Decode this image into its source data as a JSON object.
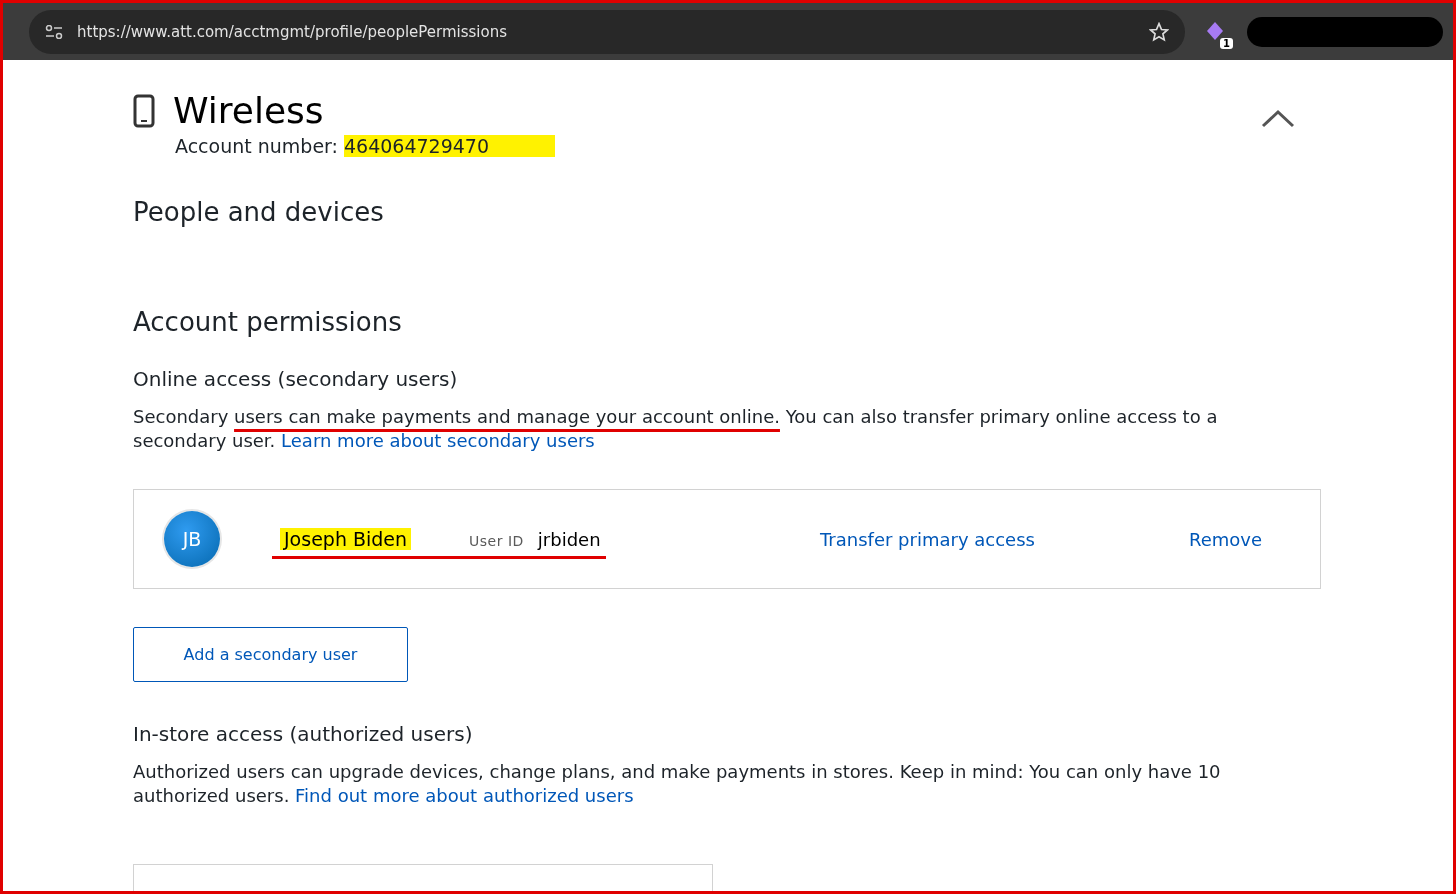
{
  "browser": {
    "url": "https://www.att.com/acctmgmt/profile/peoplePermissions",
    "extension_badge": "1",
    "profile_redacted": true
  },
  "section": {
    "title": "Wireless",
    "account_label": "Account number:",
    "account_number": "464064729470",
    "number_highlighted": true,
    "expanded": true
  },
  "people_heading": "People and devices",
  "permissions_heading": "Account permissions",
  "online_access": {
    "heading": "Online access (secondary users)",
    "text_before": "Secondary ",
    "text_underlined": "users can make payments and manage your account online.",
    "text_after": " You can also transfer primary online access to a secondary user. ",
    "link": "Learn more about secondary users",
    "users": [
      {
        "initials": "JB",
        "name": "Joseph Biden",
        "name_highlighted": true,
        "underlined": true,
        "user_id_label": "User ID",
        "user_id": "jrbiden",
        "actions": [
          "Transfer primary access",
          "Remove"
        ]
      }
    ],
    "add_button": "Add a secondary user"
  },
  "in_store_access": {
    "heading": "In-store access (authorized users)",
    "text": "Authorized users can upgrade devices, change plans, and make payments in stores. Keep in mind: You can only have 10 authorized users. ",
    "link": "Find out more about authorized users"
  }
}
